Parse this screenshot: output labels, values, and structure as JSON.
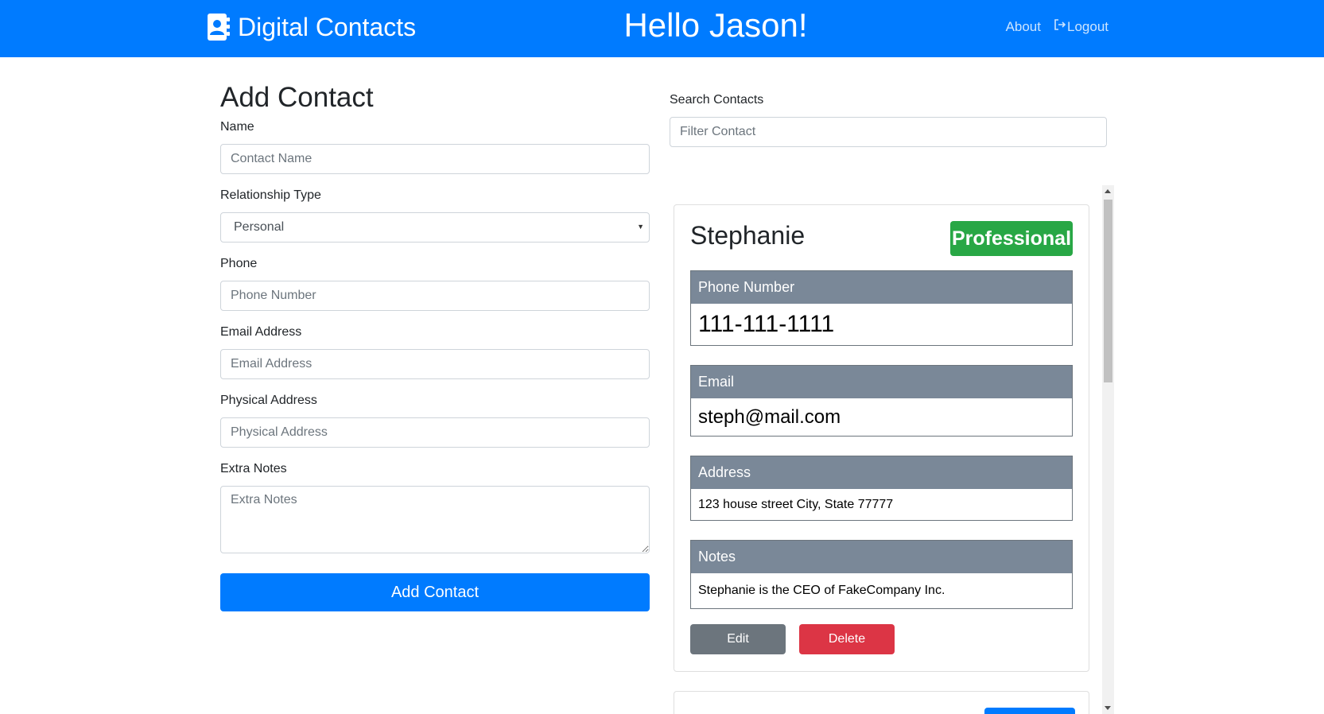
{
  "navbar": {
    "brand": "Digital Contacts",
    "greeting": "Hello Jason!",
    "about": "About",
    "logout": "Logout"
  },
  "add_form": {
    "heading": "Add Contact",
    "name_label": "Name",
    "name_placeholder": "Contact Name",
    "relationship_label": "Relationship Type",
    "relationship_value": "Personal",
    "phone_label": "Phone",
    "phone_placeholder": "Phone Number",
    "email_label": "Email Address",
    "email_placeholder": "Email Address",
    "address_label": "Physical Address",
    "address_placeholder": "Physical Address",
    "notes_label": "Extra Notes",
    "notes_placeholder": "Extra Notes",
    "submit": "Add Contact"
  },
  "search": {
    "label": "Search Contacts",
    "placeholder": "Filter Contact"
  },
  "contact": {
    "name": "Stephanie",
    "type": "Professional",
    "phone_label": "Phone Number",
    "phone": "111-111-1111",
    "email_label": "Email",
    "email": "steph@mail.com",
    "address_label": "Address",
    "address": "123 house street City, State 77777",
    "notes_label": "Notes",
    "notes": "Stephanie is the CEO of FakeCompany Inc.",
    "edit": "Edit",
    "delete": "Delete"
  },
  "colors": {
    "primary": "#007bff",
    "success": "#28a745",
    "danger": "#dc3545",
    "secondary": "#6c757d",
    "field_header": "#7a8898"
  }
}
